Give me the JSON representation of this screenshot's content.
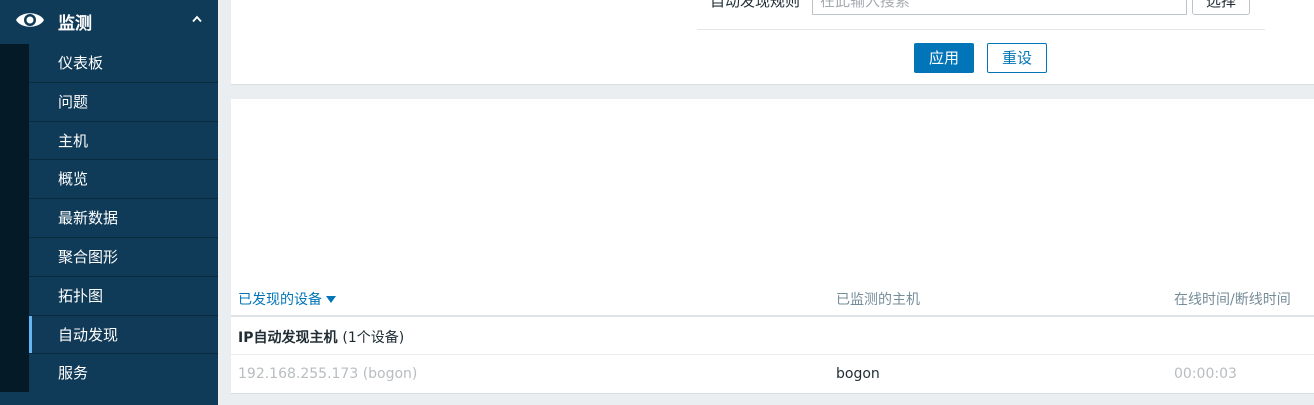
{
  "sidebar": {
    "section_title": "监测",
    "items": [
      {
        "label": "仪表板"
      },
      {
        "label": "问题"
      },
      {
        "label": "主机"
      },
      {
        "label": "概览"
      },
      {
        "label": "最新数据"
      },
      {
        "label": "聚合图形"
      },
      {
        "label": "拓扑图"
      },
      {
        "label": "自动发现"
      },
      {
        "label": "服务"
      }
    ]
  },
  "filter": {
    "rule_label": "自动发现规则",
    "rule_placeholder": "在此输入搜索",
    "select_label": "选择",
    "apply_label": "应用",
    "reset_label": "重设"
  },
  "table": {
    "columns": {
      "devices": "已发现的设备",
      "monitored_host": "已监测的主机",
      "uptime": "在线时间/断线时间"
    },
    "group": {
      "name": "IP自动发现主机",
      "count": "(1个设备)"
    },
    "rows": [
      {
        "ip": "192.168.255.173 (bogon)",
        "host": "bogon",
        "time": "00:00:03"
      }
    ]
  },
  "colors": {
    "sidebar_bg": "#0f3b58",
    "accent": "#0275b8"
  }
}
